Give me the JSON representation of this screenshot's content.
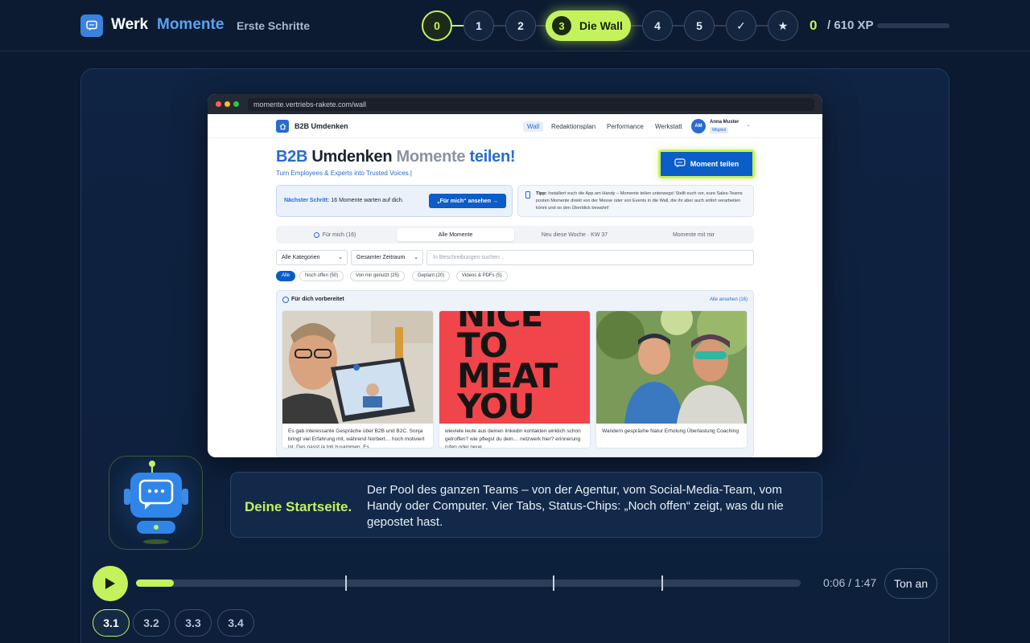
{
  "header": {
    "brand_part1": "Werk",
    "brand_part2": "Momente",
    "subtitle": "Erste Schritte",
    "steps": [
      "0",
      "1",
      "2",
      "3",
      "4",
      "5",
      "✓",
      "★"
    ],
    "active_step_number": "3",
    "active_step_label": "Die Wall",
    "xp_value": "0",
    "xp_total": "/ 610 XP",
    "xp_progress": 0
  },
  "browser": {
    "url": "momente.vertriebs-rakete.com/wall"
  },
  "site": {
    "name": "B2B Umdenken",
    "nav": [
      "Wall",
      "Redaktionsplan",
      "Performance",
      "Werkstatt"
    ],
    "user_initials": "AM",
    "user_name": "Anna Muster",
    "user_role": "Mitglied",
    "title_part1": "B2B",
    "title_part2": "Umdenken",
    "title_part3": "Momente",
    "title_part4": "teilen!",
    "tagline": "Turn Employees & Experts into Trusted Voices.|",
    "cta_label": "Moment teilen",
    "next_label": "Nächster Schritt:",
    "next_text": "16 Momente warten auf dich.",
    "next_button": "„Für mich“ ansehen →",
    "tip_label": "Tipp:",
    "tip_text": "Installiert euch die App am Handy – Momente teilen unterwegs! Stellt euch vor, eure Sales-Teams posten Momente direkt von der Messe oder von Events in die Wall, die ihr aber auch sofort verarbeiten könnt und so den Überblick bewahrt!",
    "tabs": [
      "Für mich (16)",
      "Alle Momente",
      "Neu diese Woche · KW 37",
      "Momente mit mir"
    ],
    "filter_category": "Alle Kategorien",
    "filter_period": "Gesamter Zeitraum",
    "search_placeholder": "In Beschreibungen suchen ..",
    "chips": [
      "Alle",
      "Noch offen (50)",
      "Von mir genutzt (25)",
      "Geplant (20)",
      "Videos & PDFs (5)"
    ],
    "prepared_title": "Für dich vorbereitet",
    "prepared_all": "Alle ansehen (16)",
    "cards": [
      {
        "caption": "Es gab interessante Gespräche über B2B und B2C. Sonja bringt viel Erfahrung mit, während Norbert… hoch motiviert ist. Das passt ja toll zusammen. Es…"
      },
      {
        "image_text": "NICE TO MEAT YOU",
        "caption": "wieviele leute aus deinen linkedin kontakten wirklich schon getroffen? wie pflegst du dein… netzwerk hier? erinnerung rufen oder neue…"
      },
      {
        "caption": "Wandern gespräxhe Natur Erholung Überlastung Coaching"
      }
    ]
  },
  "assistant": {
    "title": "Deine Startseite.",
    "text": "Der Pool des ganzen Teams – von der Agentur, vom Social-Media-Team, vom Handy oder Computer. Vier Tabs, Status-Chips: „Noch offen“ zeigt, was du nie gepostet hast."
  },
  "player": {
    "progress": 0.057,
    "markers": [
      0.315,
      0.627,
      0.791
    ],
    "time": "0:06 / 1:47",
    "sound_label": "Ton an",
    "sub_steps": [
      "3.1",
      "3.2",
      "3.3",
      "3.4"
    ],
    "active_sub_step": "3.1"
  },
  "colors": {
    "accent": "#c4f25c",
    "brand_blue": "#5aa2f0",
    "background": "#0b1a30"
  }
}
